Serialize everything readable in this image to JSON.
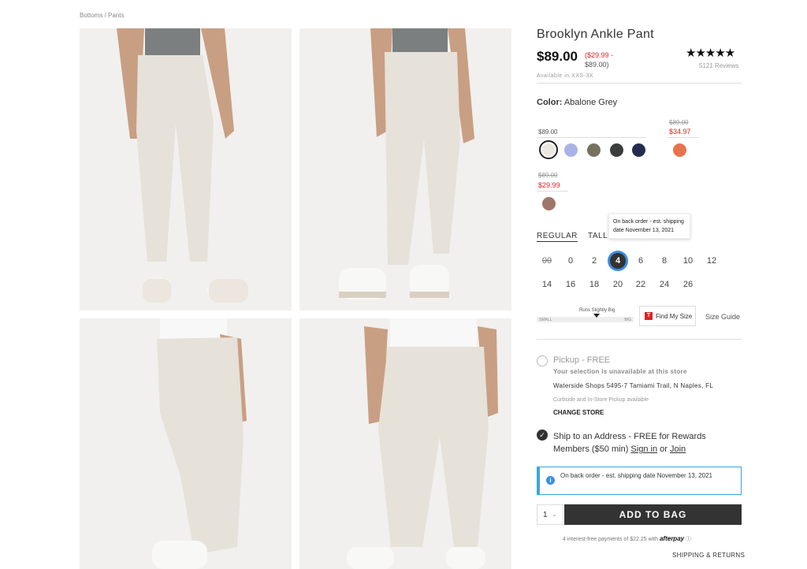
{
  "breadcrumb": "Bottoms / Pants",
  "product": {
    "title": "Brooklyn Ankle Pant",
    "price": "$89.00",
    "price_range_sale": "($29.99 -",
    "price_range_orig": "$89.00)",
    "availability": "Available in XXS-3X",
    "rating_stars": "★★★★★",
    "reviews": "5121 Reviews"
  },
  "color": {
    "label": "Color:",
    "selected": "Abalone Grey",
    "groups": [
      {
        "price": "$89.00",
        "swatches": [
          "#ece8e0",
          "#a9b3e8",
          "#75725f",
          "#3b3c3c",
          "#252d4f"
        ]
      },
      {
        "orig": "$89.00",
        "sale": "$34.97",
        "swatches": [
          "#e9734d"
        ]
      },
      {
        "orig": "$89.00",
        "sale": "$29.99",
        "swatches": [
          "#a1766a"
        ]
      }
    ]
  },
  "fit": {
    "tabs": [
      "REGULAR",
      "TALL"
    ],
    "tooltip": "On back order - est. shipping date November 13, 2021"
  },
  "sizes": {
    "row1": [
      "00",
      "0",
      "2",
      "4",
      "6",
      "8",
      "10",
      "12"
    ],
    "row2": [
      "14",
      "16",
      "18",
      "20",
      "22",
      "24",
      "26"
    ],
    "selected": "4",
    "out_of_stock": [
      "00"
    ]
  },
  "fit_meter": {
    "label": "Runs Slightly Big",
    "small": "SMALL",
    "big": "BIG",
    "level": 0.62
  },
  "find_my_size": {
    "icon": "T",
    "label": "Find My Size"
  },
  "size_guide": "Size Guide",
  "pickup": {
    "label": "Pickup - FREE",
    "unavailable": "Your selection is unavailable at this store",
    "store": "Waterside Shops 5495-7 Tamiami Trail, N Naples, FL",
    "curbside": "Curbside and In-Store Pickup available",
    "change": "CHANGE STORE"
  },
  "shipping": {
    "text": "Ship to an Address - FREE for Rewards Members ($50 min)",
    "sign_in": "Sign in",
    "or": "or",
    "join": "Join"
  },
  "notice": "On back order - est. shipping date November 13, 2021",
  "cart": {
    "qty": "1",
    "add_label": "ADD TO BAG",
    "afterpay_text": "4 interest-free payments of $22.25 with",
    "afterpay_brand": "afterpay",
    "shipping_returns": "SHIPPING & RETURNS"
  },
  "colors": {
    "accent": "#3a8ee6",
    "sale": "#dd2222",
    "button": "#333333"
  }
}
